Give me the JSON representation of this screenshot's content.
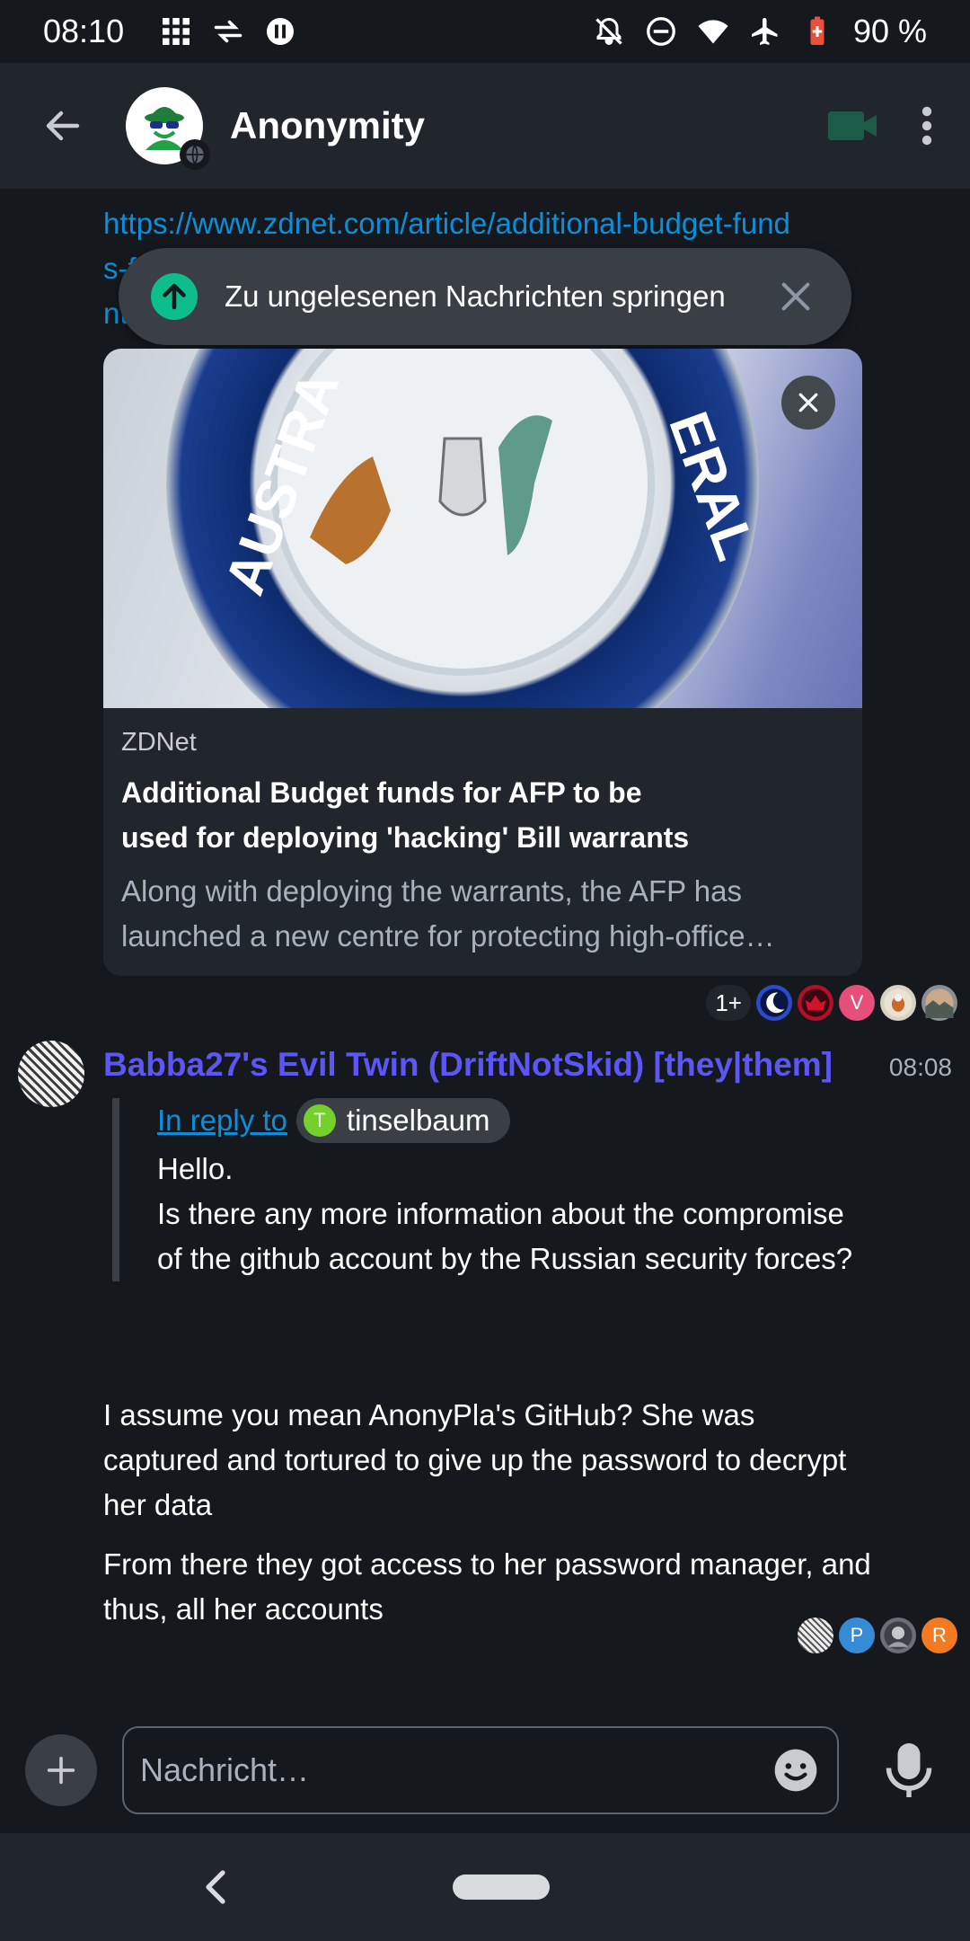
{
  "status_bar": {
    "time": "08:10",
    "battery": "90 %"
  },
  "header": {
    "title": "Anonymity"
  },
  "timeline": {
    "link_text": "https://www.zdnet.com/article/additional-budget-funds-for-afp-to-be-used-for-deploying-hacking-bill-warrants",
    "jump_banner": "Zu ungelesenen Nachrichten springen",
    "preview": {
      "site": "ZDNet",
      "title": "Additional Budget funds for AFP to be used for deploying 'hacking' Bill warrants",
      "description": "Along with deploying the warrants, the AFP has launched a new centre for protecting high-office holders"
    },
    "receipts_top": {
      "count": "1+",
      "avatars": [
        {
          "letter": "",
          "color": "#2b4cc9"
        },
        {
          "letter": "",
          "color": "#b0102a"
        },
        {
          "letter": "V",
          "color": "#e64f7a"
        },
        {
          "letter": "",
          "color": "#d9d2c2"
        },
        {
          "letter": "",
          "color": "#8a8f96"
        }
      ]
    },
    "message": {
      "sender": "Babba27's Evil Twin (DriftNotSkid) [they|them]",
      "time": "08:08",
      "reply_label": "In reply to",
      "reply_user_initial": "T",
      "reply_user": "tinselbaum",
      "quote": "Hello.\nIs there any more information about the compromise of the github account by the Russian security forces?",
      "body1": "I assume you mean AnonyPla's GitHub? She was captured and tortured to give up the password to decrypt her data",
      "body2": "From there they got access to her password manager, and thus, all her accounts"
    },
    "receipts_bottom": {
      "avatars": [
        {
          "letter": "",
          "color": "#9a9a9a"
        },
        {
          "letter": "P",
          "color": "#368bd6"
        },
        {
          "letter": "",
          "color": "#6b6f75"
        },
        {
          "letter": "R",
          "color": "#f27a22"
        }
      ]
    }
  },
  "composer": {
    "placeholder": "Nachricht…"
  },
  "colors": {
    "accent": "#0dbd8b",
    "link": "#0d8ed8",
    "sender": "#5c56f5"
  }
}
